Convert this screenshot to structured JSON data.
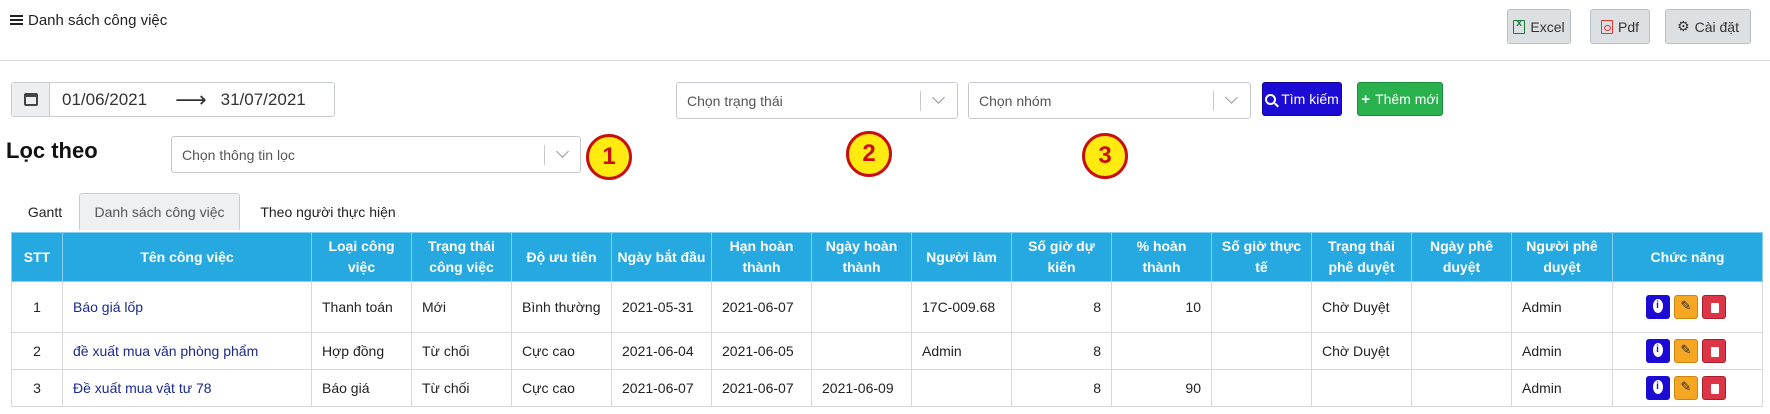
{
  "header": {
    "title": "Danh sách công việc",
    "buttons": [
      {
        "label": "Excel",
        "icon": "excel-icon"
      },
      {
        "label": "Pdf",
        "icon": "pdf-icon"
      },
      {
        "label": "Cài đặt",
        "icon": "gear-icon"
      }
    ]
  },
  "filters": {
    "date_from": "01/06/2021",
    "date_to": "31/07/2021",
    "status_placeholder": "Chọn trạng thái",
    "group_placeholder": "Chọn nhóm",
    "search_label": "Tìm kiếm",
    "add_label": "Thêm mới",
    "filter_by_label": "Lọc theo",
    "filter_info_placeholder": "Chọn thông tin lọc"
  },
  "annotations": [
    "1",
    "2",
    "3"
  ],
  "tabs": [
    {
      "label": "Gantt",
      "active": false
    },
    {
      "label": "Danh sách công việc",
      "active": true
    },
    {
      "label": "Theo người thực hiện",
      "active": false
    }
  ],
  "table": {
    "columns": [
      "STT",
      "Tên công việc",
      "Loại công việc",
      "Trạng thái công việc",
      "Độ ưu tiên",
      "Ngày bắt đầu",
      "Hạn hoàn thành",
      "Ngày hoàn thành",
      "Người làm",
      "Số giờ dự kiến",
      "% hoàn thành",
      "Số giờ thực tế",
      "Trạng thái phê duyệt",
      "Ngày phê duyệt",
      "Người phê duyệt",
      "Chức năng"
    ],
    "rows": [
      [
        "1",
        "Báo giá lốp",
        "Thanh toán",
        "Mới",
        "Bình thường",
        "2021-05-31",
        "2021-06-07",
        "",
        "17C-009.68",
        "8",
        "10",
        "",
        "Chờ Duyệt",
        "",
        "Admin"
      ],
      [
        "2",
        "đề xuất mua văn phòng phẩm",
        "Hợp đồng",
        "Từ chối",
        "Cực cao",
        "2021-06-04",
        "2021-06-05",
        "",
        "Admin",
        "8",
        "",
        "",
        "Chờ Duyệt",
        "",
        "Admin"
      ],
      [
        "3",
        "Đề xuất mua vật tư 78",
        "Báo giá",
        "Từ chối",
        "Cực cao",
        "2021-06-07",
        "2021-06-07",
        "2021-06-09",
        "",
        "8",
        "90",
        "",
        "",
        "",
        "Admin"
      ]
    ]
  },
  "colors": {
    "header_bg": "#26a8e0",
    "search_btn": "#1b0bd4",
    "add_btn": "#28b14d",
    "badge_fill": "#ffeb10",
    "badge_border": "#c80e0e"
  }
}
